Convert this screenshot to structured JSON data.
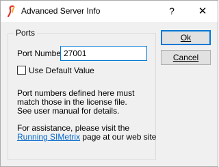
{
  "window": {
    "title": "Advanced Server Info",
    "help_glyph": "?",
    "close_glyph": "✕"
  },
  "group": {
    "label": "Ports",
    "port_label": "Port Number",
    "port_value": "27001",
    "default_checkbox_label": "Use Default Value",
    "default_checked": false
  },
  "info": {
    "lines": [
      "Port numbers defined here must",
      "match those in the license file.",
      "See user manual for details."
    ]
  },
  "assistance": {
    "line1": "For assistance, please visit the",
    "link_text": "Running SIMetrix",
    "suffix": " page at our web site"
  },
  "buttons": {
    "ok_label": "Ok",
    "cancel_label": "Cancel"
  },
  "icons": {
    "app": "simetrix-logo-icon",
    "help": "help-icon",
    "close": "close-icon"
  },
  "colors": {
    "accent": "#0078d7",
    "link": "#0066cc",
    "logo_red": "#e0312b",
    "logo_orange": "#f39c12"
  }
}
